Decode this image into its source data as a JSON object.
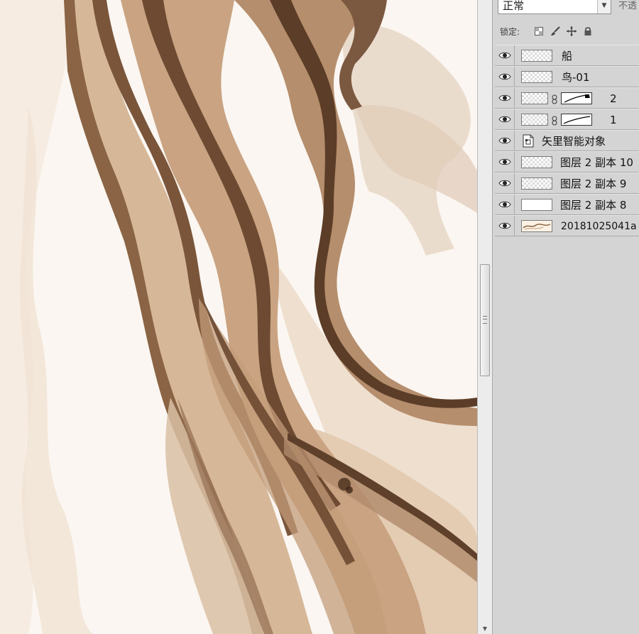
{
  "blend_mode": {
    "value": "正常",
    "opacity_label": "不透"
  },
  "lock": {
    "label": "锁定:",
    "icons": [
      "lock-transparent-icon",
      "lock-brush-icon",
      "lock-move-icon",
      "lock-all-icon"
    ]
  },
  "layers": [
    {
      "name": "船",
      "type": "pixel",
      "visible": true
    },
    {
      "name": "鸟-01",
      "type": "pixel",
      "visible": true
    },
    {
      "name": "2",
      "type": "masked",
      "visible": true
    },
    {
      "name": "1",
      "type": "masked",
      "visible": true
    },
    {
      "name": "矢里智能对象",
      "type": "smart-object",
      "visible": true
    },
    {
      "name": "图层 2 副本 10",
      "type": "pixel",
      "visible": true
    },
    {
      "name": "图层 2 副本 9",
      "type": "pixel",
      "visible": true
    },
    {
      "name": "图层 2 副本 8",
      "type": "pixel",
      "visible": true
    },
    {
      "name": "20181025041a",
      "type": "image",
      "visible": true
    }
  ],
  "colors": {
    "panel_bg": "#d4d4d4",
    "canvas_bg": "#fbf6f1",
    "ink_dark": "#6b4a32",
    "ink_mid": "#b08a6a",
    "ink_light": "#e3cdb7"
  }
}
